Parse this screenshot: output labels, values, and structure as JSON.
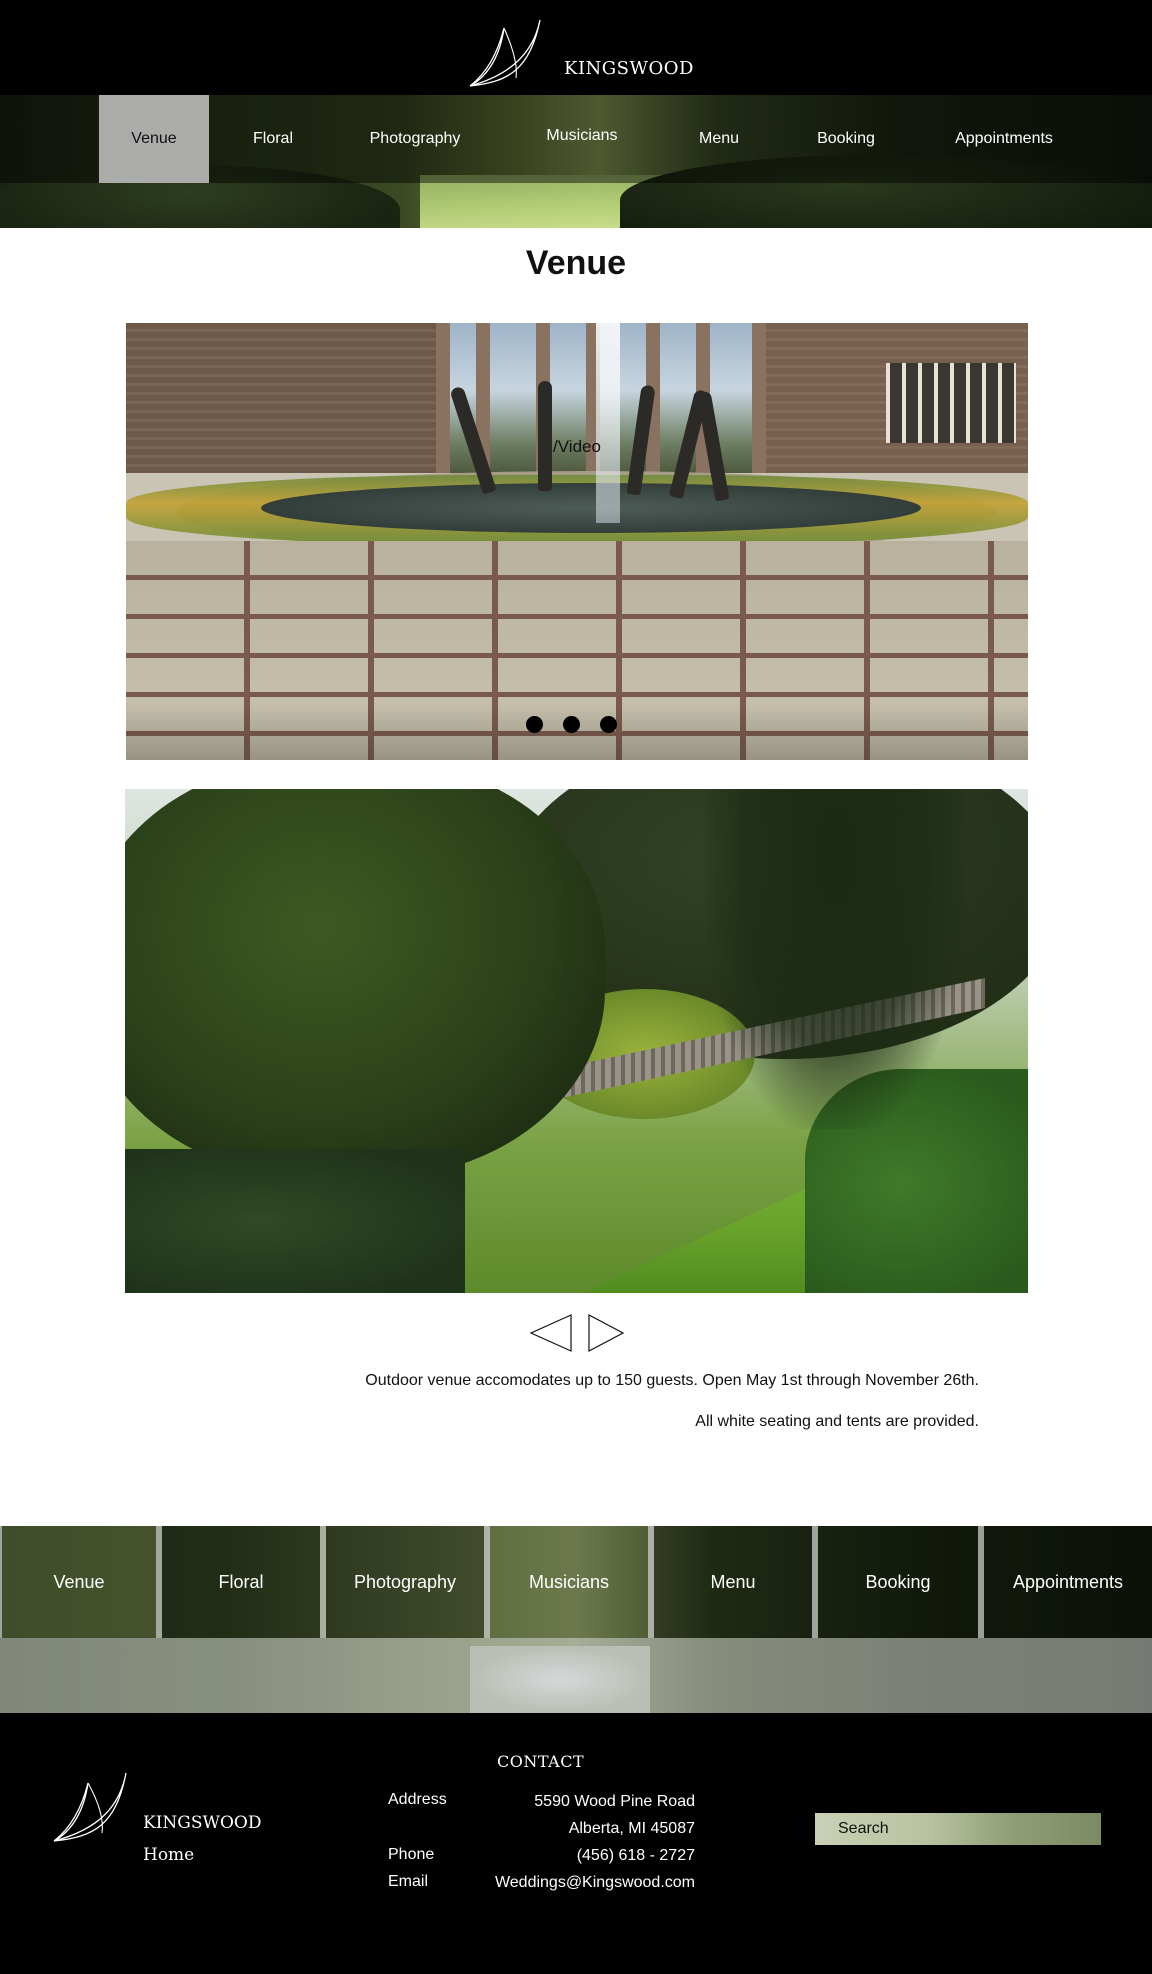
{
  "brand": {
    "name": "KINGSWOOD"
  },
  "nav": {
    "items": [
      {
        "label": "Venue",
        "active": true
      },
      {
        "label": "Floral",
        "active": false
      },
      {
        "label": "Photography",
        "active": false
      },
      {
        "label": "Musicians",
        "active": false
      },
      {
        "label": "Menu",
        "active": false
      },
      {
        "label": "Booking",
        "active": false
      },
      {
        "label": "Appointments",
        "active": false
      }
    ]
  },
  "page": {
    "title": "Venue"
  },
  "slideshow": {
    "slide_label": "/Video",
    "dot_count": 3,
    "prev_icon": "triangle-left-icon",
    "next_icon": "triangle-right-icon"
  },
  "content": {
    "description_line1": "Outdoor venue accomodates up to 150 guests. Open May 1st through November 26th.",
    "description_line2": "All white seating and tents are provided."
  },
  "bottom_nav": {
    "items": [
      "Venue",
      "Floral",
      "Photography",
      "Musicians",
      "Menu",
      "Booking",
      "Appointments"
    ]
  },
  "footer": {
    "brand": "KINGSWOOD",
    "home_link": "Home",
    "contact_title": "CONTACT",
    "address_label": "Address",
    "address_line1": "5590 Wood Pine Road",
    "address_line2": "Alberta, MI 45087",
    "phone_label": "Phone",
    "phone": "(456) 618 - 2727",
    "email_label": "Email",
    "email": "Weddings@Kingswood.com",
    "search_placeholder": "Search"
  },
  "colors": {
    "header_bg": "#000000",
    "active_nav_bg": "#cdcdcd",
    "footer_bg": "#000000"
  }
}
